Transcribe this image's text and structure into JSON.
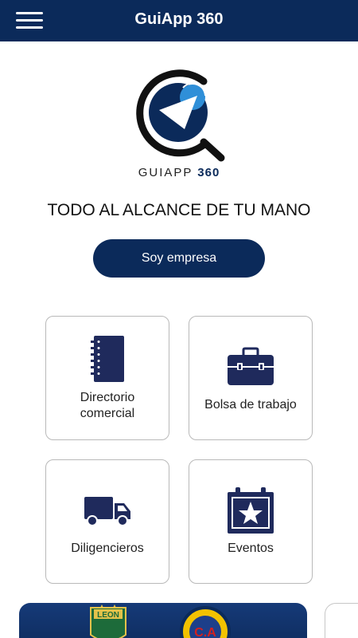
{
  "header": {
    "title": "GuiApp 360"
  },
  "logo": {
    "wordmark": "GUIAPP",
    "number": "360"
  },
  "tagline": "TODO AL ALCANCE DE TU MANO",
  "cta": {
    "label": "Soy empresa"
  },
  "tiles": [
    {
      "label_line1": "Directorio",
      "label_line2": "comercial",
      "icon": "notebook-icon"
    },
    {
      "label": "Bolsa de trabajo",
      "icon": "briefcase-icon"
    },
    {
      "label": "Diligencieros",
      "icon": "truck-icon"
    },
    {
      "label": "Eventos",
      "icon": "calendar-star-icon"
    }
  ],
  "banner": {
    "logos": [
      "LEON",
      "C.A"
    ]
  },
  "colors": {
    "primary": "#0b2a5a",
    "accent": "#2f8fd8",
    "tile_border": "#b9b9b9"
  }
}
